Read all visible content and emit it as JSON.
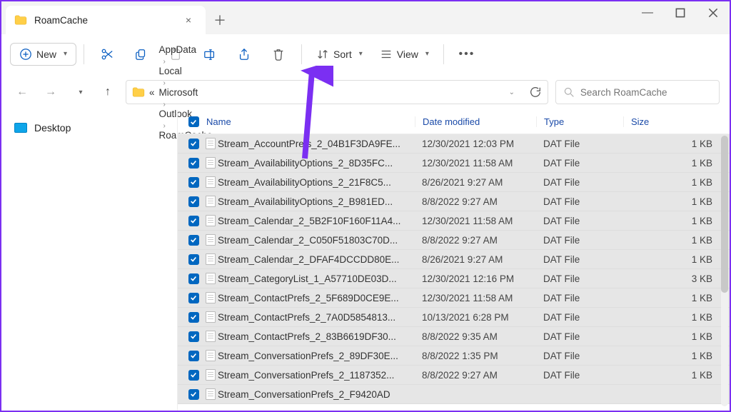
{
  "window": {
    "title": "RoamCache",
    "close": "×",
    "minimize": "—"
  },
  "toolbar": {
    "new_label": "New",
    "sort_label": "Sort",
    "view_label": "View"
  },
  "breadcrumbs": [
    "AppData",
    "Local",
    "Microsoft",
    "Outlook",
    "RoamCache"
  ],
  "breadcrumb_prefix": "«",
  "search": {
    "placeholder": "Search RoamCache"
  },
  "sidebar": {
    "items": [
      {
        "label": "Desktop"
      }
    ]
  },
  "columns": {
    "name": "Name",
    "date": "Date modified",
    "type": "Type",
    "size": "Size"
  },
  "files": [
    {
      "name": "Stream_AccountPrefs_2_04B1F3DA9FE...",
      "date": "12/30/2021 12:03 PM",
      "type": "DAT File",
      "size": "1 KB"
    },
    {
      "name": "Stream_AvailabilityOptions_2_8D35FC...",
      "date": "12/30/2021 11:58 AM",
      "type": "DAT File",
      "size": "1 KB"
    },
    {
      "name": "Stream_AvailabilityOptions_2_21F8C5...",
      "date": "8/26/2021 9:27 AM",
      "type": "DAT File",
      "size": "1 KB"
    },
    {
      "name": "Stream_AvailabilityOptions_2_B981ED...",
      "date": "8/8/2022 9:27 AM",
      "type": "DAT File",
      "size": "1 KB"
    },
    {
      "name": "Stream_Calendar_2_5B2F10F160F11A4...",
      "date": "12/30/2021 11:58 AM",
      "type": "DAT File",
      "size": "1 KB"
    },
    {
      "name": "Stream_Calendar_2_C050F51803C70D...",
      "date": "8/8/2022 9:27 AM",
      "type": "DAT File",
      "size": "1 KB"
    },
    {
      "name": "Stream_Calendar_2_DFAF4DCCDD80E...",
      "date": "8/26/2021 9:27 AM",
      "type": "DAT File",
      "size": "1 KB"
    },
    {
      "name": "Stream_CategoryList_1_A57710DE03D...",
      "date": "12/30/2021 12:16 PM",
      "type": "DAT File",
      "size": "3 KB"
    },
    {
      "name": "Stream_ContactPrefs_2_5F689D0CE9E...",
      "date": "12/30/2021 11:58 AM",
      "type": "DAT File",
      "size": "1 KB"
    },
    {
      "name": "Stream_ContactPrefs_2_7A0D5854813...",
      "date": "10/13/2021 6:28 PM",
      "type": "DAT File",
      "size": "1 KB"
    },
    {
      "name": "Stream_ContactPrefs_2_83B6619DF30...",
      "date": "8/8/2022 9:35 AM",
      "type": "DAT File",
      "size": "1 KB"
    },
    {
      "name": "Stream_ConversationPrefs_2_89DF30E...",
      "date": "8/8/2022 1:35 PM",
      "type": "DAT File",
      "size": "1 KB"
    },
    {
      "name": "Stream_ConversationPrefs_2_1187352...",
      "date": "8/8/2022 9:27 AM",
      "type": "DAT File",
      "size": "1 KB"
    },
    {
      "name": "Stream_ConversationPrefs_2_F9420AD",
      "date": "",
      "type": "",
      "size": ""
    }
  ]
}
